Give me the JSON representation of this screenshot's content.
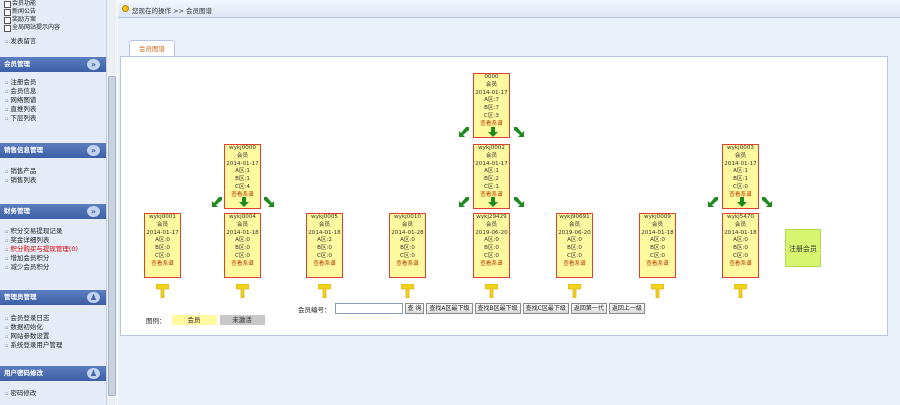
{
  "sidebar": {
    "top_items": [
      "会员功能",
      "新闻公告",
      "奖励方案",
      "全局网站提示内容"
    ],
    "sections": [
      {
        "title": "",
        "items": [
          "发表留言"
        ]
      },
      {
        "title": "会员管理",
        "items": [
          "注册会员",
          "会员信息",
          "网络图谱",
          "直推列表",
          "下层列表"
        ]
      },
      {
        "title": "销售信息管理",
        "items": [
          "销售产品",
          "销售列表"
        ]
      },
      {
        "title": "财务管理",
        "items": [
          "积分交易提现记录",
          "奖金详细列表",
          "积分购买与提现管理(0)",
          "增加会员积分",
          "减少会员积分"
        ]
      },
      {
        "title": "管理员管理",
        "items": [
          "会员登录日志",
          "数据初始化",
          "网站参数设置",
          "系统登录用户管理"
        ]
      },
      {
        "title": "用户密码修改",
        "items": [
          "密码修改"
        ]
      }
    ]
  },
  "breadcrumb": "您现在的操作 >> 会员图谱",
  "tab": "会员图谱",
  "tree": {
    "nodes": [
      [
        "0000",
        "会员",
        "2014-01-17",
        "A区:7",
        "B区:7",
        "C区:3",
        "查看系谱"
      ],
      [
        "wykj0000",
        "会员",
        "2014-01-17",
        "A区:1",
        "B区:1",
        "C区:4",
        "查看系谱"
      ],
      [
        "wykj0002",
        "会员",
        "2014-01-17",
        "A区:1",
        "B区:2",
        "C区:1",
        "查看系谱"
      ],
      [
        "wykj0003",
        "会员",
        "2014-01-17",
        "A区:1",
        "B区:1",
        "C区:0",
        "查看系谱"
      ],
      [
        "wykj0001",
        "会员",
        "2014-01-17",
        "A区:0",
        "B区:0",
        "C区:0",
        "查看系谱"
      ],
      [
        "wykj0004",
        "会员",
        "2014-01-18",
        "A区:0",
        "B区:0",
        "C区:0",
        "查看系谱"
      ],
      [
        "wykj0005",
        "会员",
        "2014-01-18",
        "A区:2",
        "B区:0",
        "C区:0",
        "查看系谱"
      ],
      [
        "wykj0010",
        "会员",
        "2014-01-28",
        "A区:0",
        "B区:0",
        "C区:0",
        "查看系谱"
      ],
      [
        "wykj29429",
        "会员",
        "2019-06-20",
        "A区:0",
        "B区:0",
        "C区:0",
        "查看系谱"
      ],
      [
        "wykj90691",
        "会员",
        "2019-06-20",
        "A区:0",
        "B区:0",
        "C区:0",
        "查看系谱"
      ],
      [
        "wykj0009",
        "会员",
        "2014-01-18",
        "A区:0",
        "B区:0",
        "C区:0",
        "查看系谱"
      ],
      [
        "wykj5470",
        "会员",
        "2014-01-18",
        "A区:0",
        "B区:0",
        "C区:0",
        "查看系谱"
      ]
    ],
    "empty_node": "注册会员"
  },
  "legend": {
    "label": "图例：",
    "yellow": "会员",
    "gray": "未激活"
  },
  "search": {
    "label": "会员编号：",
    "value": "",
    "buttons": [
      "查 询",
      "查找A区最下级",
      "查找B区最下级",
      "查找C区最下级",
      "返回第一代",
      "返回上一级"
    ]
  },
  "colors": {
    "node_bg": "#fffaa0",
    "node_border": "#e04030",
    "arrow": "#1f8a1f",
    "header": "#3d5fa6",
    "empty_node": "#d8f570",
    "inactive": "#c8c8c8"
  }
}
